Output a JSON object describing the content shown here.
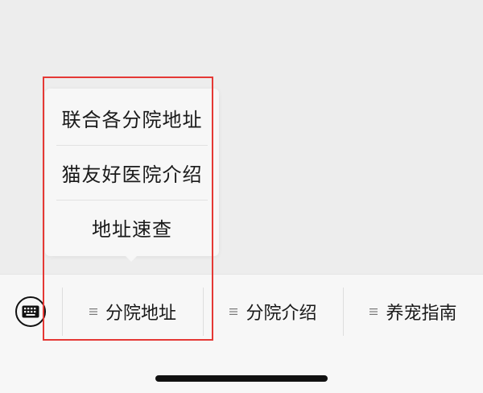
{
  "submenu": {
    "items": [
      {
        "label": "联合各分院地址"
      },
      {
        "label": "猫友好医院介绍"
      },
      {
        "label": "地址速查"
      }
    ]
  },
  "menubar": {
    "keyboard_icon": "keyboard-icon",
    "tabs": [
      {
        "label": "分院地址",
        "icon": "list-icon"
      },
      {
        "label": "分院介绍",
        "icon": "list-icon"
      },
      {
        "label": "养宠指南",
        "icon": "list-icon"
      }
    ]
  },
  "colors": {
    "background": "#ededed",
    "menu_surface": "#f7f7f7",
    "text": "#1a1a1a",
    "highlight": "#e53935"
  }
}
